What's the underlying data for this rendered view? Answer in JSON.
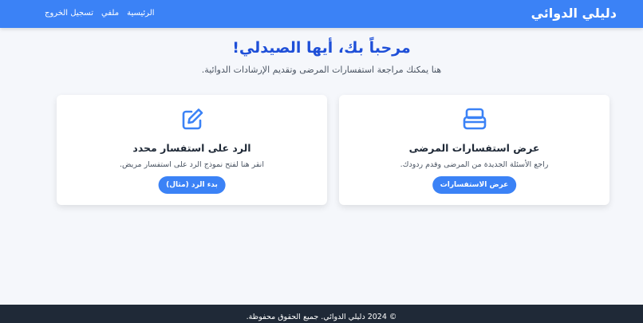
{
  "header": {
    "brand": "دليلي الدوائي",
    "nav": [
      {
        "label": "الرئيسية"
      },
      {
        "label": "ملفي"
      },
      {
        "label": "تسجيل الخروج"
      }
    ]
  },
  "welcome": {
    "title": "مرحباً بك، أيها الصيدلي!",
    "subtitle": "هنا يمكنك مراجعة استفسارات المرضى وتقديم الإرشادات الدوائية."
  },
  "cards": [
    {
      "icon": "inbox-icon",
      "title": "عرض استفسارات المرضى",
      "description": "راجع الأسئلة الجديدة من المرضى وقدم ردودك.",
      "button": "عرض الاستفسارات"
    },
    {
      "icon": "edit-icon",
      "title": "الرد على استفسار محدد",
      "description": "انقر هنا لفتح نموذج الرد على استفسار مريض.",
      "button": "بدء الرد (مثال)"
    }
  ],
  "footer": {
    "text": "© 2024 دليلي الدوائي. جميع الحقوق محفوظة."
  },
  "colors": {
    "primary": "#3b82f6",
    "title": "#1e4fd8",
    "footer": "#1f2937",
    "background": "#f5f7fb"
  }
}
